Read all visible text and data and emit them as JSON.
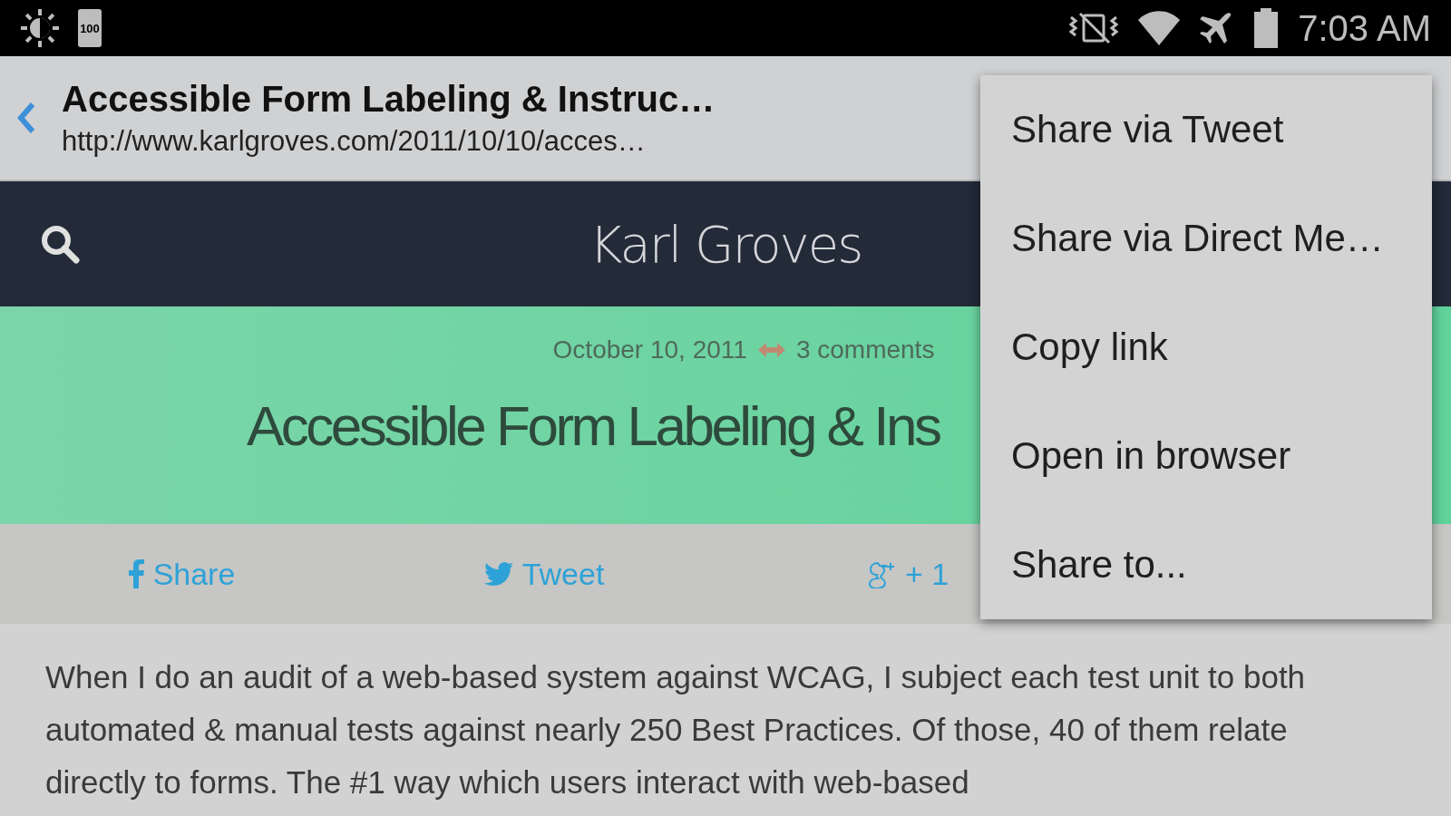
{
  "status_bar": {
    "battery_label": "100",
    "time": "7:03 AM"
  },
  "app_bar": {
    "title": "Accessible Form Labeling & Instruc…",
    "url": "http://www.karlgroves.com/2011/10/10/acces…"
  },
  "site_header": {
    "site_name": "Karl Groves"
  },
  "post": {
    "date": "October 10, 2011",
    "comments": "3 comments",
    "title": "Accessible Form Labeling & Ins"
  },
  "share_bar": [
    {
      "kind": "facebook",
      "label": "Share"
    },
    {
      "kind": "twitter",
      "label": "Tweet"
    },
    {
      "kind": "gplus",
      "label": "+ 1"
    }
  ],
  "body": "When I do an audit of a web-based system against WCAG, I subject each test unit to both automated & manual tests against nearly 250 Best Practices. Of those, 40 of them relate directly to forms. The #1 way which users interact with web-based",
  "menu": [
    "Share via Tweet",
    "Share via Direct Me…",
    "Copy link",
    "Open in browser",
    "Share to..."
  ]
}
